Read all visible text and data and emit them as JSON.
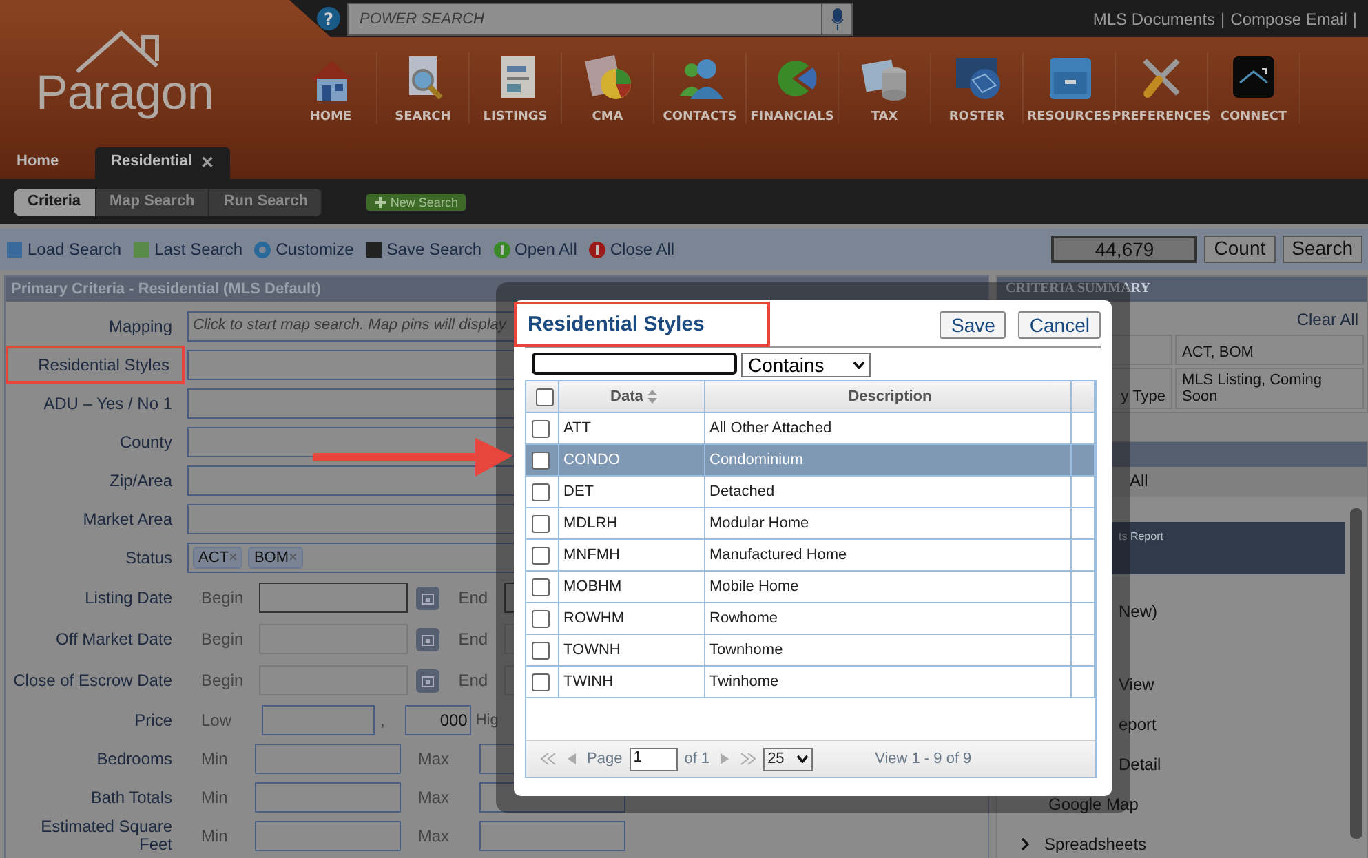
{
  "top_bar": {
    "help": "?",
    "search": {
      "placeholder": "POWER SEARCH"
    },
    "links": [
      {
        "label": "MLS Documents",
        "separator": "|"
      },
      {
        "label": "Compose Email",
        "separator": "|"
      }
    ]
  },
  "logo": "Paragon",
  "nav": [
    "HOME",
    "SEARCH",
    "LISTINGS",
    "CMA",
    "CONTACTS",
    "FINANCIALS",
    "TAX",
    "ROSTER",
    "RESOURCES",
    "PREFERENCES",
    "CONNECT"
  ],
  "tabs": [
    {
      "label": "Home",
      "selected": false
    },
    {
      "label": "Residential",
      "selected": true,
      "close": "✕"
    }
  ],
  "subtabs": [
    {
      "label": "Criteria",
      "selected": true
    },
    {
      "label": "Map Search",
      "selected": false
    },
    {
      "label": "Run Search",
      "selected": false
    }
  ],
  "new_search": "New Search",
  "toolbar": {
    "actions": [
      "Load Search",
      "Last Search",
      "Customize",
      "Save Search",
      "Open All",
      "Close All"
    ],
    "count": "44,679",
    "buttons": [
      "Count",
      "Search"
    ]
  },
  "criteria": {
    "title": "Primary Criteria - Residential (MLS Default)",
    "fields": [
      {
        "kind": "text",
        "label": "Mapping",
        "placeholder": "Click to start map search. Map pins will display",
        "highlighted": false
      },
      {
        "kind": "text",
        "label": "Residential Styles",
        "highlighted": true
      },
      {
        "kind": "text",
        "label": "ADU – Yes / No 1",
        "highlighted": false
      },
      {
        "kind": "text",
        "label": "County",
        "highlighted": false
      },
      {
        "kind": "text",
        "label": "Zip/Area",
        "highlighted": false
      },
      {
        "kind": "text",
        "label": "Market Area",
        "highlighted": false
      },
      {
        "kind": "tags",
        "label": "Status",
        "highlighted": false,
        "tags": [
          {
            "label": "ACT",
            "remove": "×"
          },
          {
            "label": "BOM",
            "remove": "×"
          }
        ]
      },
      {
        "kind": "date",
        "label": "Listing Date",
        "highlighted": false,
        "begin": "Begin",
        "end": "End",
        "disabled": false
      },
      {
        "kind": "date",
        "label": "Off Market Date",
        "highlighted": false,
        "begin": "Begin",
        "end": "End",
        "disabled": true
      },
      {
        "kind": "date",
        "label": "Close of Escrow Date",
        "highlighted": false,
        "begin": "Begin",
        "end": "End",
        "disabled": true
      },
      {
        "kind": "price",
        "label": "Price",
        "highlighted": false,
        "low": "Low",
        "separator": ",",
        "thousands": "000",
        "high": "Hig"
      },
      {
        "kind": "range",
        "label": "Bedrooms",
        "highlighted": false,
        "min": "Min",
        "max": "Max"
      },
      {
        "kind": "range",
        "label": "Bath Totals",
        "highlighted": false,
        "min": "Min",
        "max": "Max"
      },
      {
        "kind": "range",
        "label": "Estimated Square Feet",
        "highlighted": false,
        "min": "Min",
        "max": "Max"
      }
    ]
  },
  "summary": {
    "title": "CRITERIA SUMMARY",
    "clear": "Clear All",
    "rows": [
      {
        "value": "ACT, BOM"
      },
      {
        "label": "y Type",
        "value": "MLS Listing, Coming Soon"
      }
    ]
  },
  "results": {
    "select_all": "All",
    "items": [
      {
        "label": "ts Report",
        "kind": "partial",
        "selected": true
      },
      {
        "label": "New)",
        "kind": "partial",
        "selected": false
      },
      {
        "label": "View",
        "kind": "partial",
        "selected": false
      },
      {
        "label": "eport",
        "kind": "partial",
        "selected": false
      },
      {
        "label": "Detail",
        "kind": "partial",
        "selected": false
      },
      {
        "label": "Google Map",
        "kind": "item",
        "selected": false
      },
      {
        "label": "Spreadsheets",
        "kind": "group",
        "selected": false
      }
    ]
  },
  "dialog": {
    "title": "Residential Styles",
    "title_highlighted": true,
    "all_checked": false,
    "buttons": [
      "Save",
      "Cancel"
    ],
    "operator": "Contains",
    "columns": [
      "Data",
      "Description"
    ],
    "rows": [
      {
        "data": "ATT",
        "description": "All Other Attached",
        "checked": false,
        "selected": false
      },
      {
        "data": "CONDO",
        "description": "Condominium",
        "checked": false,
        "selected": true
      },
      {
        "data": "DET",
        "description": "Detached",
        "checked": false,
        "selected": false
      },
      {
        "data": "MDLRH",
        "description": "Modular Home",
        "checked": false,
        "selected": false
      },
      {
        "data": "MNFMH",
        "description": "Manufactured Home",
        "checked": false,
        "selected": false
      },
      {
        "data": "MOBHM",
        "description": "Mobile Home",
        "checked": false,
        "selected": false
      },
      {
        "data": "ROWHM",
        "description": "Rowhome",
        "checked": false,
        "selected": false
      },
      {
        "data": "TOWNH",
        "description": "Townhome",
        "checked": false,
        "selected": false
      },
      {
        "data": "TWINH",
        "description": "Twinhome",
        "checked": false,
        "selected": false
      }
    ],
    "pager": {
      "page_label": "Page",
      "page": "1",
      "of": "of 1",
      "per_page": "25",
      "view": "View 1 - 9 of 9"
    }
  }
}
